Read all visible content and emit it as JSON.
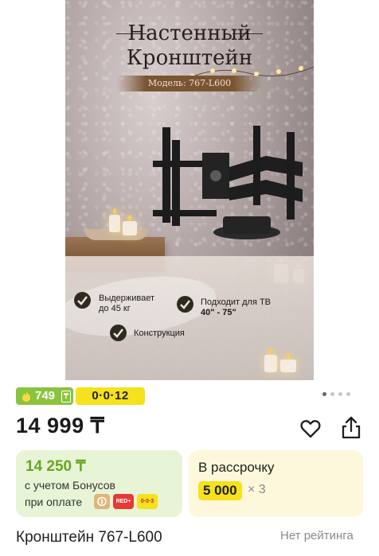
{
  "product_image": {
    "title_line1": "Настенный",
    "title_line2": "Кронштейн",
    "model": "Модель: 767-L600",
    "features": [
      {
        "line1": "Выдерживает",
        "line2": "до 45 кг"
      },
      {
        "line1": "Подходит для ТВ",
        "line2": "40\" - 75\""
      },
      {
        "line1": "Конструкция",
        "line2": ""
      }
    ]
  },
  "carousel": {
    "count": 4,
    "active_index": 0
  },
  "promo": {
    "bonus_value": "749",
    "bonus_currency_icon": "₸",
    "bonus_icon": "flame-icon",
    "bonus_color": "#8ac33c",
    "installment_label": "0·0·12",
    "installment_color": "#f5e11c"
  },
  "price": "14 999 ₸",
  "actions": {
    "favorite_icon": "heart-icon",
    "share_icon": "share-icon"
  },
  "bonus_card": {
    "price": "14 250 ₸",
    "line1": "с учетом Бонусов",
    "line2": "при оплате",
    "pay_icons": [
      "Kaspi",
      "RED+",
      "0·0·3"
    ]
  },
  "installment_card": {
    "label": "В рассрочку",
    "amount": "5 000",
    "multiplier": "× 3"
  },
  "product_name": "Кронштейн 767-L600",
  "rating_text": "Нет рейтинга"
}
